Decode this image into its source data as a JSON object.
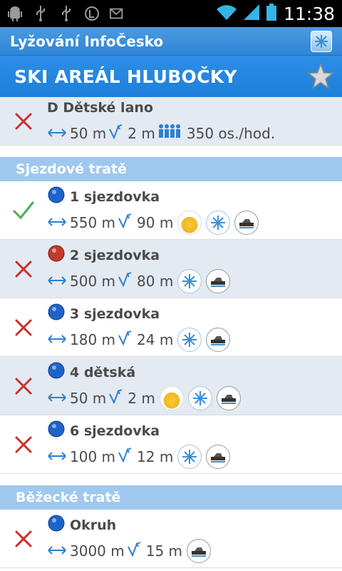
{
  "status": {
    "time": "11:38"
  },
  "app": {
    "title": "Lyžování InfoČesko"
  },
  "page": {
    "title": "SKI AREÁL HLUBOČKY"
  },
  "colors": {
    "accent": "#2e8ee6",
    "open": "#4caf50",
    "closed": "#c9302c"
  },
  "lifts": [
    {
      "name": "D Dětské lano",
      "length": "50 m",
      "height": "2 m",
      "capacity": "350 os./hod.",
      "status": "closed"
    }
  ],
  "sections": {
    "downhill": "Sjezdové tratě",
    "crosscountry": "Běžecké tratě"
  },
  "slopes": [
    {
      "name": "1 sjezdovka",
      "difficulty": "blue",
      "length": "550 m",
      "height": "90 m",
      "status": "open",
      "icons": [
        "sun",
        "snow",
        "groom"
      ]
    },
    {
      "name": "2 sjezdovka",
      "difficulty": "red",
      "length": "500 m",
      "height": "80 m",
      "status": "closed",
      "icons": [
        "snow",
        "groom"
      ]
    },
    {
      "name": "3 sjezdovka",
      "difficulty": "blue",
      "length": "180 m",
      "height": "24 m",
      "status": "closed",
      "icons": [
        "snow",
        "groom"
      ]
    },
    {
      "name": "4 dětská",
      "difficulty": "blue",
      "length": "50 m",
      "height": "2 m",
      "status": "closed",
      "icons": [
        "sun",
        "snow",
        "groom"
      ]
    },
    {
      "name": "6 sjezdovka",
      "difficulty": "blue",
      "length": "100 m",
      "height": "12 m",
      "status": "closed",
      "icons": [
        "snow",
        "groom"
      ]
    }
  ],
  "trails": [
    {
      "name": "Okruh",
      "difficulty": "blue",
      "length": "3000 m",
      "height": "15 m",
      "status": "closed",
      "icons": [
        "groom"
      ]
    }
  ]
}
